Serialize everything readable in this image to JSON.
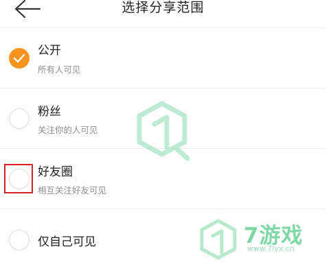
{
  "header": {
    "title": "选择分享范围"
  },
  "options": [
    {
      "title": "公开",
      "subtitle": "所有人可见",
      "selected": true
    },
    {
      "title": "粉丝",
      "subtitle": "关注你的人可见",
      "selected": false
    },
    {
      "title": "好友圈",
      "subtitle": "相互关注好友可见",
      "selected": false
    },
    {
      "title": "仅自己可见",
      "subtitle": "",
      "selected": false
    }
  ],
  "watermark": {
    "brand": "7游戏",
    "url": "www.7lyx.cn"
  },
  "colors": {
    "accent": "#f7931e",
    "highlight": "#d6232a",
    "watermark": "#7fd8a6"
  },
  "icons": {
    "back": "arrow-left-icon",
    "check": "check-icon",
    "logo": "hex-logo-icon"
  }
}
